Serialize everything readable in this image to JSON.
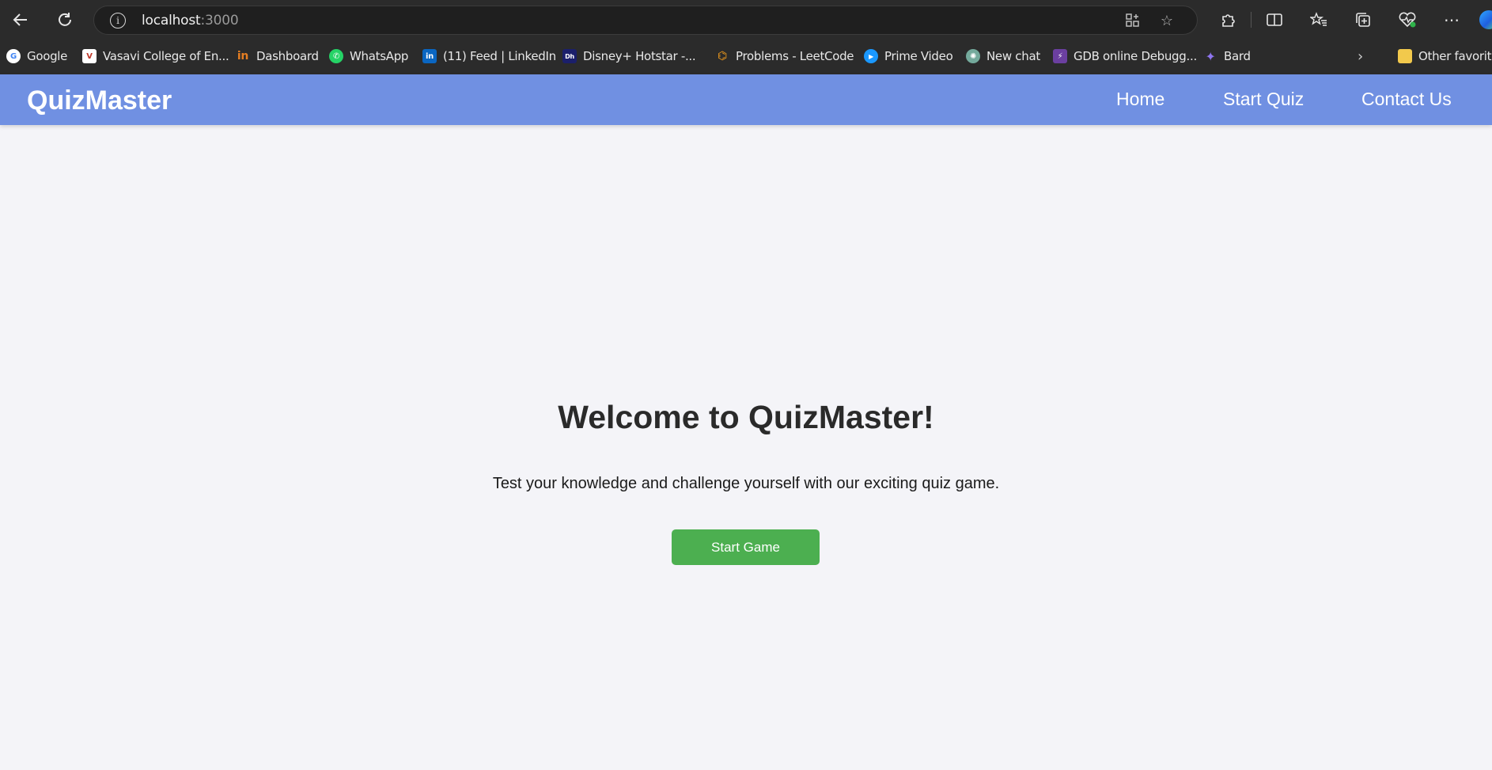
{
  "browser": {
    "url_host": "localhost",
    "url_port": ":3000",
    "bookmarks": [
      {
        "label": "Google",
        "icon": "google-icon",
        "color": "#4285f4"
      },
      {
        "label": "Vasavi College of En...",
        "icon": "college-logo-icon",
        "color": "#c0392b"
      },
      {
        "label": "Dashboard",
        "icon": "dashboard-icon",
        "color": "#e67e22"
      },
      {
        "label": "WhatsApp",
        "icon": "whatsapp-icon",
        "color": "#25d366"
      },
      {
        "label": "(11) Feed | LinkedIn",
        "icon": "linkedin-icon",
        "color": "#0a66c2"
      },
      {
        "label": "Disney+ Hotstar -...",
        "icon": "hotstar-icon",
        "color": "#1b1f6b"
      },
      {
        "label": "Problems - LeetCode",
        "icon": "leetcode-icon",
        "color": "#f89f1b"
      },
      {
        "label": "Prime Video",
        "icon": "prime-video-icon",
        "color": "#1a98ff"
      },
      {
        "label": "New chat",
        "icon": "chatgpt-icon",
        "color": "#74aa9c"
      },
      {
        "label": "GDB online Debugg...",
        "icon": "gdb-icon",
        "color": "#6b3fa0"
      },
      {
        "label": "Bard",
        "icon": "bard-sparkle-icon",
        "color": "#8e75f0"
      }
    ],
    "other_favorites": "Other favorites"
  },
  "app": {
    "brand": "QuizMaster",
    "nav": [
      "Home",
      "Start Quiz",
      "Contact Us"
    ],
    "heading": "Welcome to QuizMaster!",
    "tagline": "Test your knowledge and challenge yourself with our exciting quiz game.",
    "cta": "Start Game",
    "colors": {
      "navbar": "#7090e2",
      "button": "#4caf50",
      "background": "#f4f4f8"
    }
  }
}
